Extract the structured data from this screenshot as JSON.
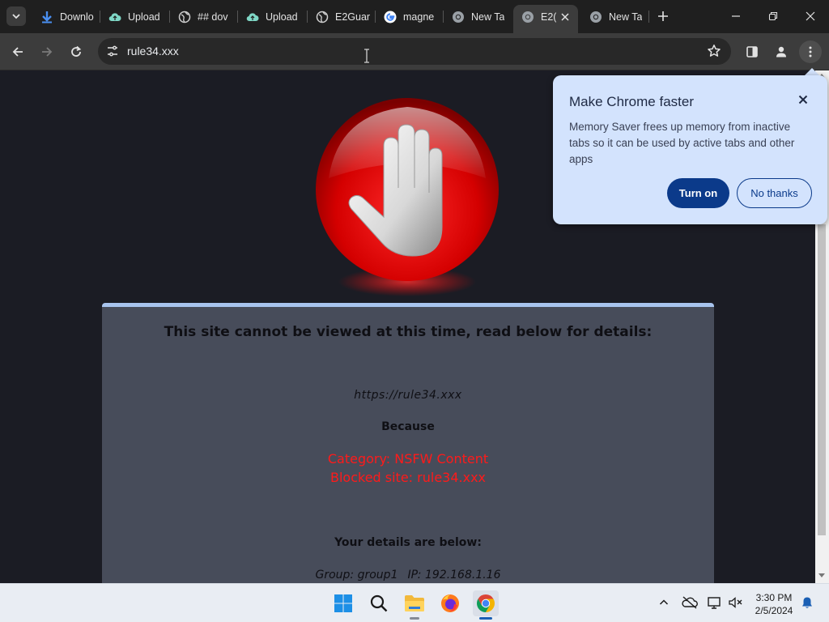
{
  "browser": {
    "tabs": [
      {
        "title": "Downlo",
        "icon": "download-icon"
      },
      {
        "title": "Upload",
        "icon": "cloud-icon"
      },
      {
        "title": "## dov",
        "icon": "globe-icon"
      },
      {
        "title": "Upload",
        "icon": "cloud-icon"
      },
      {
        "title": "E2Guar",
        "icon": "globe-icon"
      },
      {
        "title": "magne",
        "icon": "google-icon"
      },
      {
        "title": "New Ta",
        "icon": "chrome-icon"
      },
      {
        "title": "E2(",
        "icon": "chrome-icon",
        "active": true
      },
      {
        "title": "New Ta",
        "icon": "chrome-icon"
      }
    ],
    "address": "rule34.xxx"
  },
  "page": {
    "headline": "This site cannot be viewed at this time, read below for details:",
    "url": "https://rule34.xxx",
    "because": "Because",
    "category": "Category: NSFW Content",
    "blocked_site": "Blocked site: rule34.xxx",
    "details_heading": "Your details are below:",
    "group": "Group: group1",
    "ip": "IP: 192.168.1.16"
  },
  "popup": {
    "title": "Make Chrome faster",
    "body": "Memory Saver frees up memory from inactive tabs so it can be used by active tabs and other apps",
    "turn_on": "Turn on",
    "no_thanks": "No thanks"
  },
  "taskbar": {
    "time": "3:30 PM",
    "date": "2/5/2024",
    "apps": [
      "windows-start-icon",
      "search-icon",
      "file-explorer-icon",
      "firefox-icon",
      "chrome-icon"
    ]
  },
  "colors": {
    "popup_bg": "#d3e3fd",
    "primary_button": "#0b3a8a",
    "block_reason_red": "#ff1a1a",
    "panel_border": "#a8c4ee"
  }
}
